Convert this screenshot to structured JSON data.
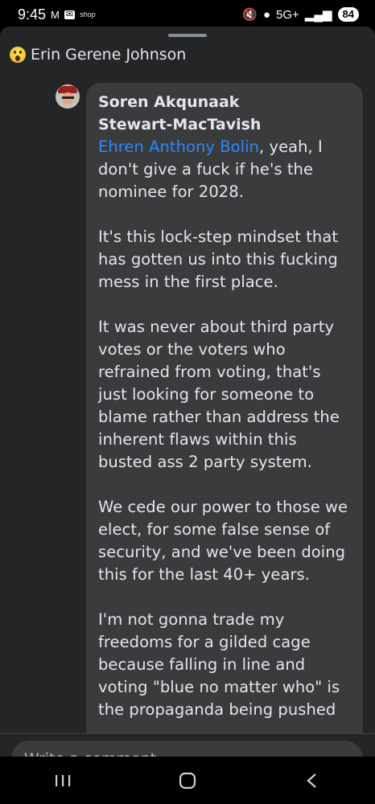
{
  "status_bar": {
    "time": "9:45",
    "mail_icon": "gmail-icon",
    "shop_label": "shop",
    "network": "5G+",
    "battery": "84"
  },
  "header": {
    "reaction_icon": "wow-emoji-icon",
    "name": "Erin Gerene Johnson"
  },
  "comment": {
    "author_line1": "Soren Akqunaak",
    "author_line2": "Stewart-MacTavish",
    "mention": "Ehren Anthony Bolin",
    "first_line_rest": ", yeah, I",
    "body": "don't give a fuck if he's the\nnominee for 2028.\n\nIt's this lock-step mindset that\nhas gotten us into this fucking\nmess in the first place.\n\nIt was never about third party\nvotes or the voters who\nrefrained from voting, that's\njust looking for someone to\nblame rather than address the\ninherent flaws within this\nbusted ass 2 party system.\n\nWe cede our power to those we\nelect, for some false sense of\nsecurity, and we've been doing\nthis for the last 40+ years.\n\nI'm not gonna trade my\nfreedoms for a gilded cage\nbecause falling in line and\nvoting \"blue no matter who\" is\nthe propaganda being pushed"
  },
  "composer": {
    "placeholder": "Write a comment..."
  },
  "nav": {
    "recents_icon": "recents-icon",
    "home_icon": "home-icon",
    "back_icon": "back-icon"
  }
}
